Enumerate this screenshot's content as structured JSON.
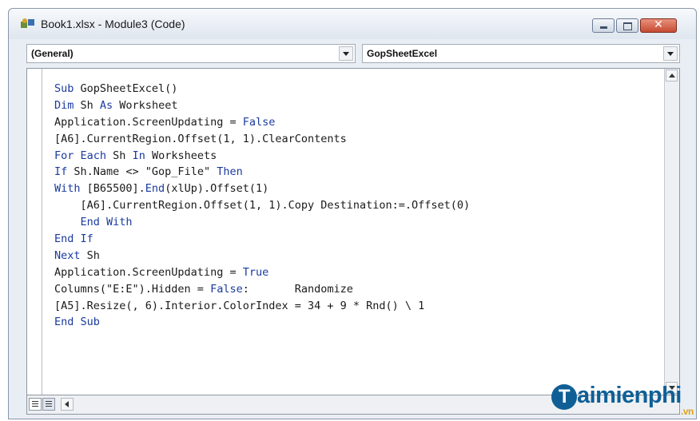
{
  "window": {
    "title": "Book1.xlsx - Module3 (Code)",
    "close_glyph": "✕"
  },
  "combos": {
    "object_value": "(General)",
    "procedure_value": "GopSheetExcel"
  },
  "code_lines": [
    "Sub GopSheetExcel()",
    "Dim Sh As Worksheet",
    "Application.ScreenUpdating = False",
    "[A6].CurrentRegion.Offset(1, 1).ClearContents",
    "For Each Sh In Worksheets",
    "If Sh.Name <> \"Gop_File\" Then",
    "With [B65500].End(xlUp).Offset(1)",
    "    [A6].CurrentRegion.Offset(1, 1).Copy Destination:=.Offset(0)",
    "    End With",
    "End If",
    "Next Sh",
    "Application.ScreenUpdating = True",
    "Columns(\"E:E\").Hidden = False:       Randomize",
    "[A5].Resize(, 6).Interior.ColorIndex = 34 + 9 * Rnd() \\ 1",
    "End Sub"
  ],
  "colors": {
    "keyword": "#1a3a9e",
    "text": "#1a1a1a",
    "close_button": "#c64a32"
  },
  "icons": {
    "app": "vba-module-icon",
    "minimize": "minimize-icon",
    "maximize": "maximize-icon",
    "close": "close-icon",
    "dropdown": "chevron-down-icon",
    "scroll_up": "arrow-up-icon",
    "scroll_down": "arrow-down-icon",
    "scroll_left": "arrow-left-icon",
    "procedure_view": "procedure-view-icon",
    "full_module_view": "full-module-view-icon"
  },
  "watermark": {
    "logo_letter": "T",
    "name": "aimienphi",
    "suffix": ".vn"
  }
}
